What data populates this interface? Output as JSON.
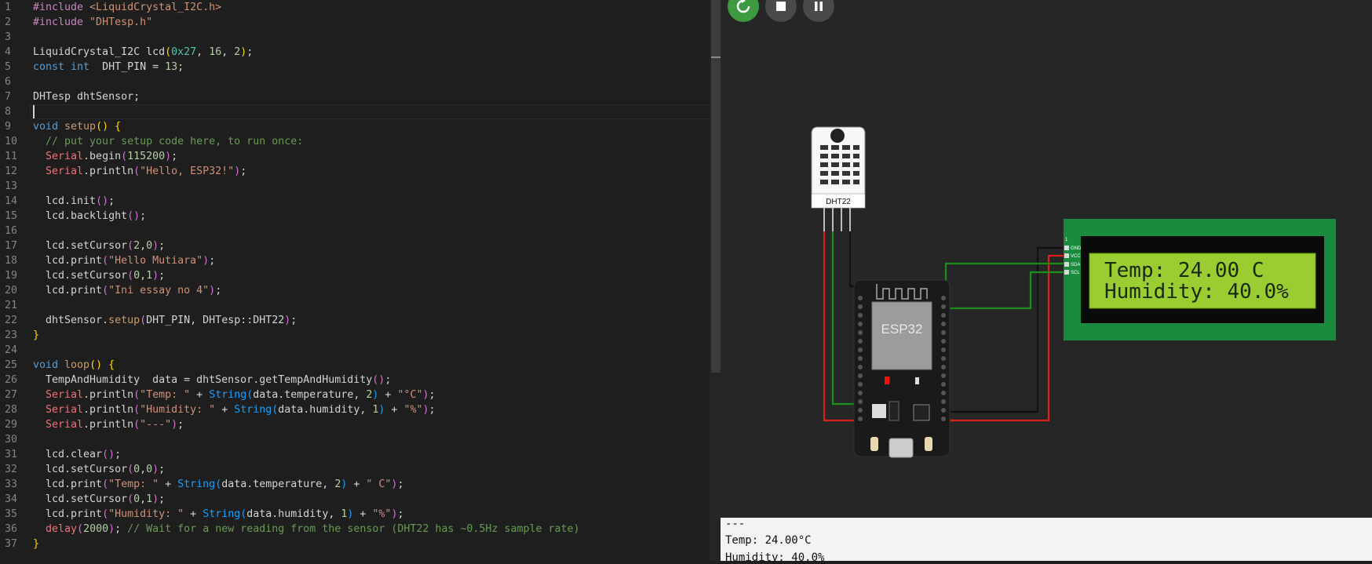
{
  "editor": {
    "lines": [
      {
        "n": "1",
        "t": [
          [
            "pur",
            "#include"
          ],
          [
            "",
            ""
          ],
          [
            "s",
            " <LiquidCrystal_I2C.h>"
          ]
        ]
      },
      {
        "n": "2",
        "t": [
          [
            "pur",
            "#include"
          ],
          [
            "s",
            " \"DHTesp.h\""
          ]
        ]
      },
      {
        "n": "3",
        "t": []
      },
      {
        "n": "4",
        "t": [
          [
            "",
            "LiquidCrystal_I2C lcd"
          ],
          [
            "p1",
            "("
          ],
          [
            "hex",
            "0x27"
          ],
          [
            "",
            ", "
          ],
          [
            "n",
            "16"
          ],
          [
            "",
            ", "
          ],
          [
            "n",
            "2"
          ],
          [
            "p1",
            ")"
          ],
          [
            "",
            ";"
          ]
        ]
      },
      {
        "n": "5",
        "t": [
          [
            "k",
            "const"
          ],
          [
            "",
            ""
          ],
          [
            "k",
            " int"
          ],
          [
            "",
            ""
          ],
          [
            "",
            "  DHT_PIN = "
          ],
          [
            "n",
            "13"
          ],
          [
            "",
            ";"
          ]
        ]
      },
      {
        "n": "6",
        "t": []
      },
      {
        "n": "7",
        "t": [
          [
            "",
            "DHTesp dhtSensor;"
          ]
        ]
      },
      {
        "n": "8",
        "t": []
      },
      {
        "n": "9",
        "t": [
          [
            "k",
            "void"
          ],
          [
            "fs",
            " setup"
          ],
          [
            "p1",
            "()"
          ],
          [
            "",
            " "
          ],
          [
            "p1",
            "{"
          ]
        ]
      },
      {
        "n": "10",
        "t": [
          [
            "c",
            "  // put your setup code here, to run once:"
          ]
        ]
      },
      {
        "n": "11",
        "t": [
          [
            "ser",
            "  Serial"
          ],
          [
            "",
            ".begin"
          ],
          [
            "p2",
            "("
          ],
          [
            "n",
            "115200"
          ],
          [
            "p2",
            ")"
          ],
          [
            "",
            ";"
          ]
        ]
      },
      {
        "n": "12",
        "t": [
          [
            "ser",
            "  Serial"
          ],
          [
            "",
            ".println"
          ],
          [
            "p2",
            "("
          ],
          [
            "s",
            "\"Hello, ESP32!\""
          ],
          [
            "p2",
            ")"
          ],
          [
            "",
            ";"
          ]
        ]
      },
      {
        "n": "13",
        "t": []
      },
      {
        "n": "14",
        "t": [
          [
            "",
            "  lcd.init"
          ],
          [
            "p2",
            "()"
          ],
          [
            "",
            ";"
          ]
        ]
      },
      {
        "n": "15",
        "t": [
          [
            "",
            "  lcd.backlight"
          ],
          [
            "p2",
            "()"
          ],
          [
            "",
            ";"
          ]
        ]
      },
      {
        "n": "16",
        "t": []
      },
      {
        "n": "17",
        "t": [
          [
            "",
            "  lcd.setCursor"
          ],
          [
            "p2",
            "("
          ],
          [
            "n",
            "2"
          ],
          [
            "",
            ","
          ],
          [
            "n",
            "0"
          ],
          [
            "p2",
            ")"
          ],
          [
            "",
            ";"
          ]
        ]
      },
      {
        "n": "18",
        "t": [
          [
            "",
            "  lcd.print"
          ],
          [
            "p2",
            "("
          ],
          [
            "s",
            "\"Hello Mutiara\""
          ],
          [
            "p2",
            ")"
          ],
          [
            "",
            ";"
          ]
        ]
      },
      {
        "n": "19",
        "t": [
          [
            "",
            "  lcd.setCursor"
          ],
          [
            "p2",
            "("
          ],
          [
            "n",
            "0"
          ],
          [
            "",
            ","
          ],
          [
            "n",
            "1"
          ],
          [
            "p2",
            ")"
          ],
          [
            "",
            ";"
          ]
        ]
      },
      {
        "n": "20",
        "t": [
          [
            "",
            "  lcd.print"
          ],
          [
            "p2",
            "("
          ],
          [
            "s",
            "\"Ini essay no 4\""
          ],
          [
            "p2",
            ")"
          ],
          [
            "",
            ";"
          ]
        ]
      },
      {
        "n": "21",
        "t": []
      },
      {
        "n": "22",
        "t": [
          [
            "",
            "  dhtSensor."
          ],
          [
            "fs",
            "setup"
          ],
          [
            "p2",
            "("
          ],
          [
            "",
            "DHT_PIN, DHTesp::DHT22"
          ],
          [
            "p2",
            ")"
          ],
          [
            "",
            ";"
          ]
        ]
      },
      {
        "n": "23",
        "t": [
          [
            "p1",
            "}"
          ]
        ]
      },
      {
        "n": "24",
        "t": []
      },
      {
        "n": "25",
        "t": [
          [
            "k",
            "void"
          ],
          [
            "fs",
            " loop"
          ],
          [
            "p1",
            "()"
          ],
          [
            "",
            " "
          ],
          [
            "p1",
            "{"
          ]
        ]
      },
      {
        "n": "26",
        "t": [
          [
            "",
            "  TempAndHumidity  data = dhtSensor.getTempAndHumidity"
          ],
          [
            "p2",
            "()"
          ],
          [
            "",
            ";"
          ]
        ]
      },
      {
        "n": "27",
        "t": [
          [
            "ser",
            "  Serial"
          ],
          [
            "",
            ".println"
          ],
          [
            "p2",
            "("
          ],
          [
            "s",
            "\"Temp: \""
          ],
          [
            "",
            " + "
          ],
          [
            "p3",
            "String"
          ],
          [
            "p3",
            "("
          ],
          [
            "",
            "data.temperature, "
          ],
          [
            "n",
            "2"
          ],
          [
            "p3",
            ")"
          ],
          [
            "",
            " + "
          ],
          [
            "s",
            "\"°C\""
          ],
          [
            "p2",
            ")"
          ],
          [
            "",
            ";"
          ]
        ]
      },
      {
        "n": "28",
        "t": [
          [
            "ser",
            "  Serial"
          ],
          [
            "",
            ".println"
          ],
          [
            "p2",
            "("
          ],
          [
            "s",
            "\"Humidity: \""
          ],
          [
            "",
            " + "
          ],
          [
            "p3",
            "String"
          ],
          [
            "p3",
            "("
          ],
          [
            "",
            "data.humidity, "
          ],
          [
            "n",
            "1"
          ],
          [
            "p3",
            ")"
          ],
          [
            "",
            " + "
          ],
          [
            "s",
            "\"%\""
          ],
          [
            "p2",
            ")"
          ],
          [
            "",
            ";"
          ]
        ]
      },
      {
        "n": "29",
        "t": [
          [
            "ser",
            "  Serial"
          ],
          [
            "",
            ".println"
          ],
          [
            "p2",
            "("
          ],
          [
            "s",
            "\"---\""
          ],
          [
            "p2",
            ")"
          ],
          [
            "",
            ";"
          ]
        ]
      },
      {
        "n": "30",
        "t": []
      },
      {
        "n": "31",
        "t": [
          [
            "",
            "  lcd.clear"
          ],
          [
            "p2",
            "()"
          ],
          [
            "",
            ";"
          ]
        ]
      },
      {
        "n": "32",
        "t": [
          [
            "",
            "  lcd.setCursor"
          ],
          [
            "p2",
            "("
          ],
          [
            "n",
            "0"
          ],
          [
            "",
            ","
          ],
          [
            "n",
            "0"
          ],
          [
            "p2",
            ")"
          ],
          [
            "",
            ";"
          ]
        ]
      },
      {
        "n": "33",
        "t": [
          [
            "",
            "  lcd.print"
          ],
          [
            "p2",
            "("
          ],
          [
            "s",
            "\"Temp: \""
          ],
          [
            "",
            " + "
          ],
          [
            "p3",
            "String"
          ],
          [
            "p3",
            "("
          ],
          [
            "",
            "data.temperature, "
          ],
          [
            "n",
            "2"
          ],
          [
            "p3",
            ")"
          ],
          [
            "",
            " + "
          ],
          [
            "s",
            "\" C\""
          ],
          [
            "p2",
            ")"
          ],
          [
            "",
            ";"
          ]
        ]
      },
      {
        "n": "34",
        "t": [
          [
            "",
            "  lcd.setCursor"
          ],
          [
            "p2",
            "("
          ],
          [
            "n",
            "0"
          ],
          [
            "",
            ","
          ],
          [
            "n",
            "1"
          ],
          [
            "p2",
            ")"
          ],
          [
            "",
            ";"
          ]
        ]
      },
      {
        "n": "35",
        "t": [
          [
            "",
            "  lcd.print"
          ],
          [
            "p2",
            "("
          ],
          [
            "s",
            "\"Humidity: \""
          ],
          [
            "",
            " + "
          ],
          [
            "p3",
            "String"
          ],
          [
            "p3",
            "("
          ],
          [
            "",
            "data.humidity, "
          ],
          [
            "n",
            "1"
          ],
          [
            "p3",
            ")"
          ],
          [
            "",
            " + "
          ],
          [
            "s",
            "\"%\""
          ],
          [
            "p2",
            ")"
          ],
          [
            "",
            ";"
          ]
        ]
      },
      {
        "n": "36",
        "t": [
          [
            "ser",
            "  delay"
          ],
          [
            "p2",
            "("
          ],
          [
            "n",
            "2000"
          ],
          [
            "p2",
            ")"
          ],
          [
            "",
            "; "
          ],
          [
            "c",
            "// Wait for a new reading from the sensor (DHT22 has ~0.5Hz sample rate)"
          ]
        ]
      },
      {
        "n": "37",
        "t": [
          [
            "p1",
            "}"
          ]
        ]
      }
    ]
  },
  "simulator": {
    "controls": [
      {
        "name": "restart-button",
        "icon": "restart-icon",
        "color": "#3d9a41"
      },
      {
        "name": "stop-button",
        "icon": "stop-icon",
        "color": "#4a4a4a"
      },
      {
        "name": "pause-button",
        "icon": "pause-icon",
        "color": "#4a4a4a"
      }
    ],
    "dht_label": "DHT22",
    "esp_label": "ESP32",
    "lcd": {
      "row1": "Temp: 24.00 C",
      "row2": "Humidity: 40.0%",
      "pin_first": "1",
      "pins": [
        "GND",
        "VCC",
        "SDA",
        "SCL"
      ]
    },
    "wire_colors": {
      "red": "#d8231c",
      "black": "#111111",
      "green": "#1a8f1a"
    }
  },
  "serial": {
    "lines": [
      "---",
      "Temp: 24.00°C",
      "Humidity: 40.0%"
    ]
  }
}
